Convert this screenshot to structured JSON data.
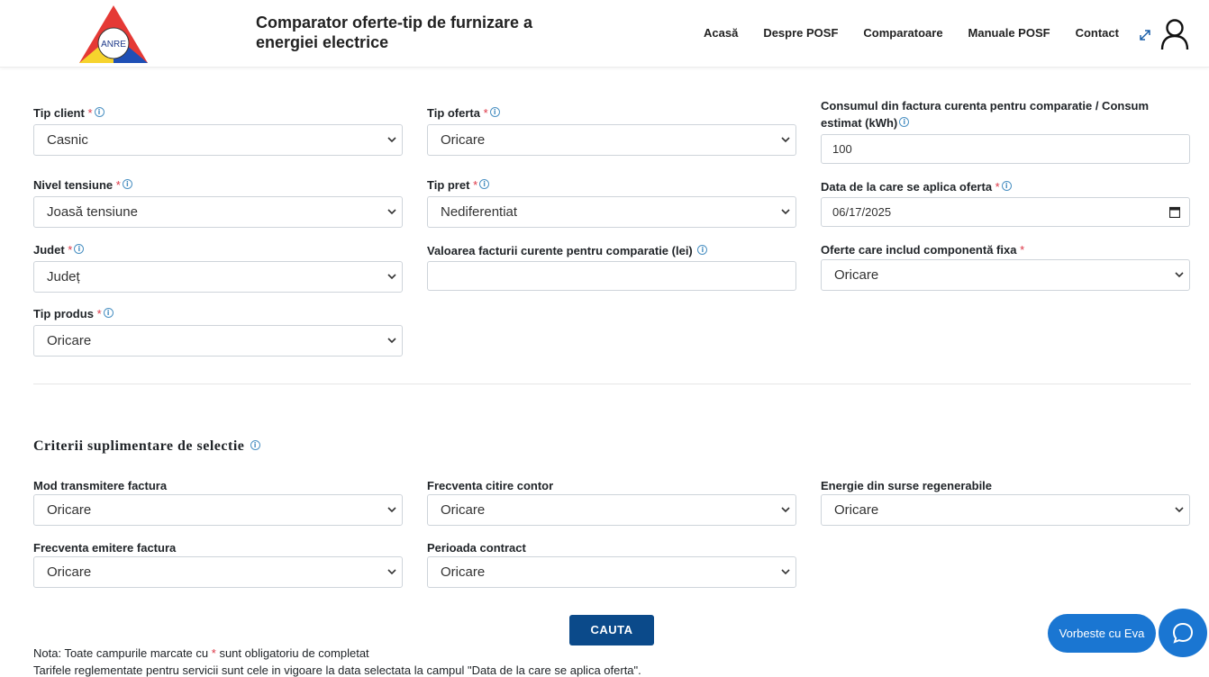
{
  "header": {
    "logo_text": "ANRE",
    "title": "Comparator oferte-tip de furnizare a energiei electrice",
    "nav": [
      "Acasă",
      "Despre POSF",
      "Comparatoare",
      "Manuale POSF",
      "Contact"
    ]
  },
  "form": {
    "tip_client": {
      "label": "Tip client",
      "value": "Casnic"
    },
    "tip_oferta": {
      "label": "Tip oferta",
      "value": "Oricare"
    },
    "consum": {
      "label": "Consumul din factura curenta pentru comparatie / Consum estimat (kWh)",
      "value": "100"
    },
    "nivel_tensiune": {
      "label": "Nivel tensiune",
      "value": "Joasă tensiune"
    },
    "tip_pret": {
      "label": "Tip pret",
      "value": "Nediferentiat"
    },
    "data_aplicare": {
      "label": "Data de la care se aplica oferta",
      "value": "06/17/2025"
    },
    "judet": {
      "label": "Judet",
      "value": "Județ"
    },
    "valoare_factura": {
      "label": "Valoarea facturii curente pentru comparatie (lei)",
      "value": ""
    },
    "componenta_fixa": {
      "label": "Oferte care includ componentă fixa",
      "value": "Oricare"
    },
    "tip_produs": {
      "label": "Tip produs",
      "value": "Oricare"
    }
  },
  "extra": {
    "title": "Criterii suplimentare de selectie",
    "mod_transmitere": {
      "label": "Mod transmitere factura",
      "value": "Oricare"
    },
    "frecventa_citire": {
      "label": "Frecventa citire contor",
      "value": "Oricare"
    },
    "energie_regenerabila": {
      "label": "Energie din surse regenerabile",
      "value": "Oricare"
    },
    "frecventa_emitere": {
      "label": "Frecventa emitere factura",
      "value": "Oricare"
    },
    "perioada_contract": {
      "label": "Perioada contract",
      "value": "Oricare"
    }
  },
  "search_label": "CAUTA",
  "notes": {
    "line1_pre": "Nota: Toate campurile marcate cu",
    "line1_star": "*",
    "line1_post": "sunt obligatoriu de completat",
    "line2": "Tarifele reglementate pentru servicii sunt cele in vigoare la data selectata la campul \"Data de la care se aplica oferta\"."
  },
  "chat": {
    "label": "Vorbeste cu Eva"
  },
  "colors": {
    "primary_button": "#0b4a8a",
    "chat": "#1a76d2",
    "required": "#dc3545",
    "info": "#4a90c2"
  }
}
